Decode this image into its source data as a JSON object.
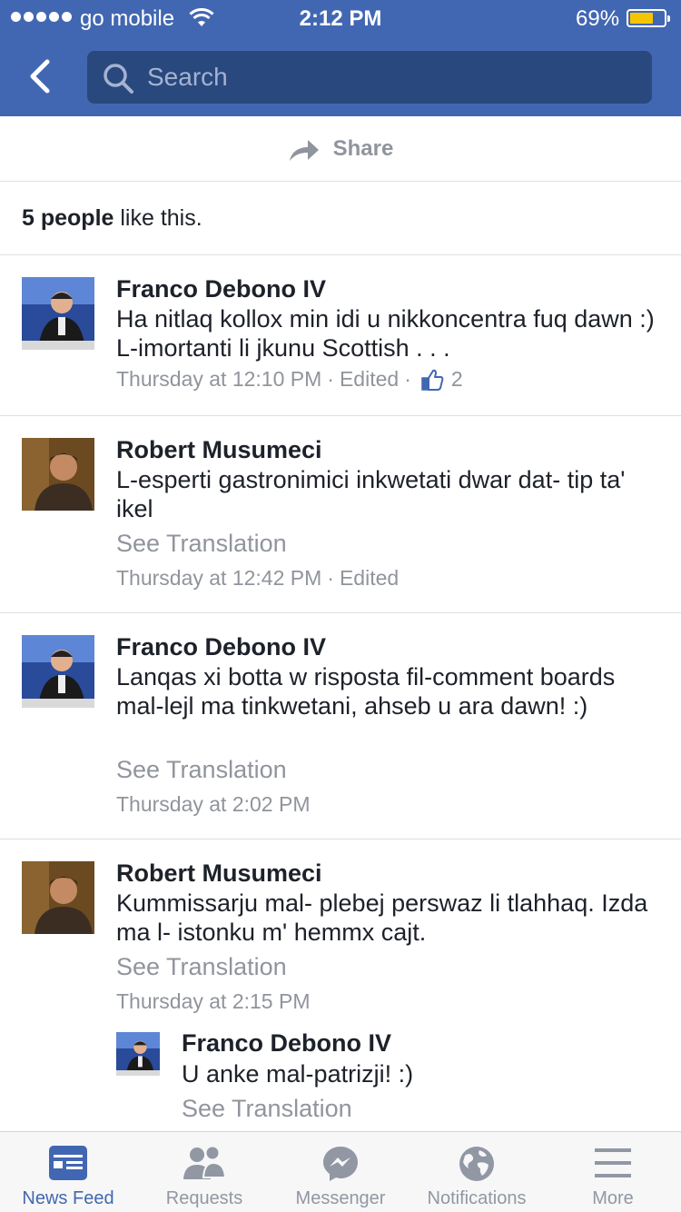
{
  "status_bar": {
    "carrier": "go mobile",
    "time": "2:12 PM",
    "battery_pct_label": "69%",
    "battery_level": 0.69,
    "signal_bars": 5
  },
  "nav": {
    "search_placeholder": "Search"
  },
  "share": {
    "label": "Share"
  },
  "likes": {
    "count_text": "5 people",
    "suffix": " like this."
  },
  "comments": [
    {
      "author": "Franco Debono IV",
      "text": "Ha nitlaq kollox min idi u nikkoncentra fuq dawn :) L-imortanti li jkunu Scottish . . .",
      "timestamp": "Thursday at 12:10 PM",
      "edited": "Edited",
      "like_count": "2"
    },
    {
      "author": "Robert Musumeci",
      "text": "L-esperti gastronimici inkwetati dwar dat- tip ta' ikel",
      "see_translation": "See Translation",
      "timestamp": "Thursday at 12:42 PM",
      "edited": "Edited"
    },
    {
      "author": "Franco Debono IV",
      "text": "Lanqas xi botta w risposta fil-comment boards mal-lejl ma tinkwetani, ahseb u ara dawn! :)",
      "see_translation": "See Translation",
      "timestamp": "Thursday at 2:02 PM"
    },
    {
      "author": "Robert Musumeci",
      "text": "Kummissarju mal- plebej perswaz li tlahhaq. Izda ma l- istonku m' hemmx cajt.",
      "see_translation": "See Translation",
      "timestamp": "Thursday at 2:15 PM"
    }
  ],
  "reply": {
    "author": "Franco Debono IV",
    "text": "U anke mal-patrizji! :)",
    "see_translation": "See Translation"
  },
  "tabbar": [
    {
      "label": "News Feed",
      "icon": "news-feed-icon",
      "active": true
    },
    {
      "label": "Requests",
      "icon": "friend-requests-icon",
      "active": false
    },
    {
      "label": "Messenger",
      "icon": "messenger-icon",
      "active": false
    },
    {
      "label": "Notifications",
      "icon": "globe-icon",
      "active": false
    },
    {
      "label": "More",
      "icon": "menu-icon",
      "active": false
    }
  ],
  "colors": {
    "brand": "#4267b2",
    "search_bg": "#29487d",
    "secondary_text": "#90949c",
    "like_blue": "#4267b2",
    "battery_fill": "#f7c500"
  }
}
